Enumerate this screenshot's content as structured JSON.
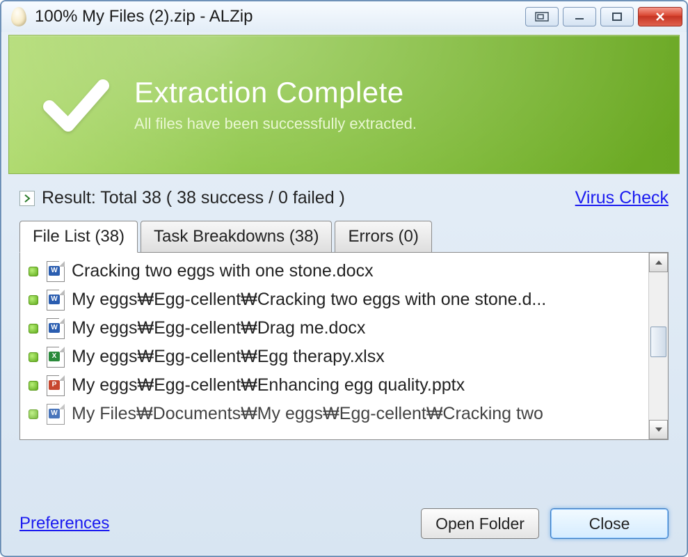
{
  "titlebar": {
    "title": "100% My Files (2).zip - ALZip"
  },
  "banner": {
    "title": "Extraction Complete",
    "subtitle": "All files have been successfully extracted."
  },
  "result": {
    "text": "Result: Total 38 ( 38 success / 0 failed )",
    "virus_link": "Virus Check"
  },
  "tabs": [
    {
      "label": "File List (38)"
    },
    {
      "label": "Task Breakdowns (38)"
    },
    {
      "label": "Errors (0)"
    }
  ],
  "files": [
    {
      "type": "word",
      "name": "Cracking two eggs with one stone.docx"
    },
    {
      "type": "word",
      "name": "My eggs₩Egg-cellent₩Cracking two eggs with one stone.d..."
    },
    {
      "type": "word",
      "name": "My eggs₩Egg-cellent₩Drag me.docx"
    },
    {
      "type": "excel",
      "name": "My eggs₩Egg-cellent₩Egg therapy.xlsx"
    },
    {
      "type": "ppt",
      "name": "My eggs₩Egg-cellent₩Enhancing egg quality.pptx"
    },
    {
      "type": "word",
      "name": "My Files₩Documents₩My eggs₩Egg-cellent₩Cracking two"
    }
  ],
  "footer": {
    "preferences": "Preferences",
    "open_folder": "Open Folder",
    "close": "Close"
  },
  "icon_badges": {
    "word": "W",
    "excel": "X",
    "ppt": "P"
  }
}
